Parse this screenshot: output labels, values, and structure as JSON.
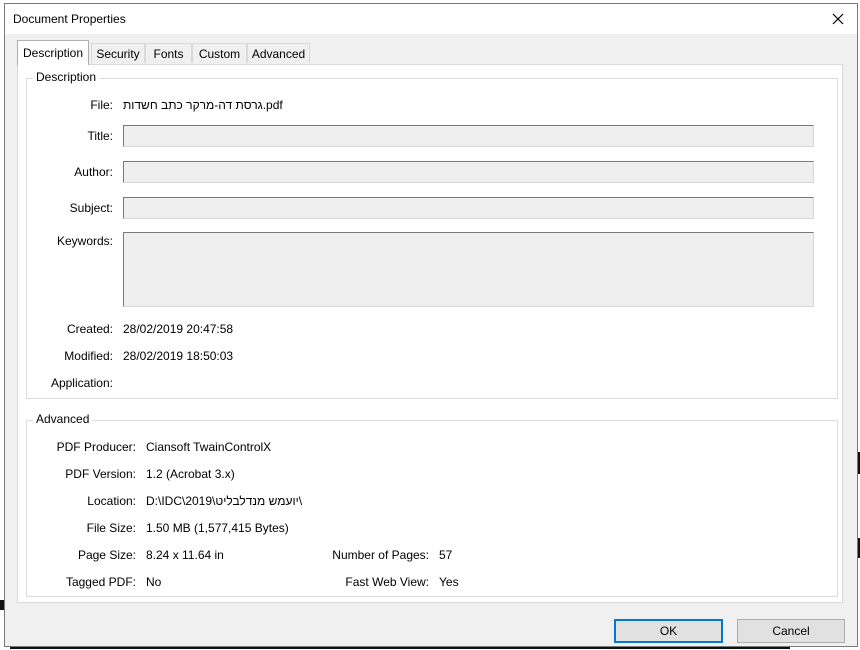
{
  "window": {
    "title": "Document Properties"
  },
  "tabs": [
    {
      "label": "Description",
      "active": true
    },
    {
      "label": "Security",
      "active": false
    },
    {
      "label": "Fonts",
      "active": false
    },
    {
      "label": "Custom",
      "active": false
    },
    {
      "label": "Advanced",
      "active": false
    }
  ],
  "description": {
    "group_title": "Description",
    "file_label": "File:",
    "file_value": "גרסת דה-מרקר כתב חשדות.pdf",
    "title_label": "Title:",
    "title_value": "",
    "author_label": "Author:",
    "author_value": "",
    "subject_label": "Subject:",
    "subject_value": "",
    "keywords_label": "Keywords:",
    "keywords_value": "",
    "created_label": "Created:",
    "created_value": "28/02/2019 20:47:58",
    "modified_label": "Modified:",
    "modified_value": "28/02/2019 18:50:03",
    "application_label": "Application:",
    "application_value": ""
  },
  "advanced": {
    "group_title": "Advanced",
    "producer_label": "PDF Producer:",
    "producer_value": "Ciansoft TwainControlX",
    "version_label": "PDF Version:",
    "version_value": "1.2 (Acrobat 3.x)",
    "location_label": "Location:",
    "location_value": "D:\\IDC\\2019\\יועמש מנדלבליט\\",
    "filesize_label": "File Size:",
    "filesize_value": "1.50 MB (1,577,415 Bytes)",
    "pagesize_label": "Page Size:",
    "pagesize_value": "8.24 x 11.64 in",
    "pages_label": "Number of Pages:",
    "pages_value": "57",
    "tagged_label": "Tagged PDF:",
    "tagged_value": "No",
    "fastweb_label": "Fast Web View:",
    "fastweb_value": "Yes"
  },
  "buttons": {
    "ok": "OK",
    "cancel": "Cancel"
  },
  "icons": {
    "close": "close-icon"
  },
  "colors": {
    "dialog_bg": "#f0f0f0",
    "panel_bg": "#ffffff",
    "default_button_border": "#0078d7"
  }
}
